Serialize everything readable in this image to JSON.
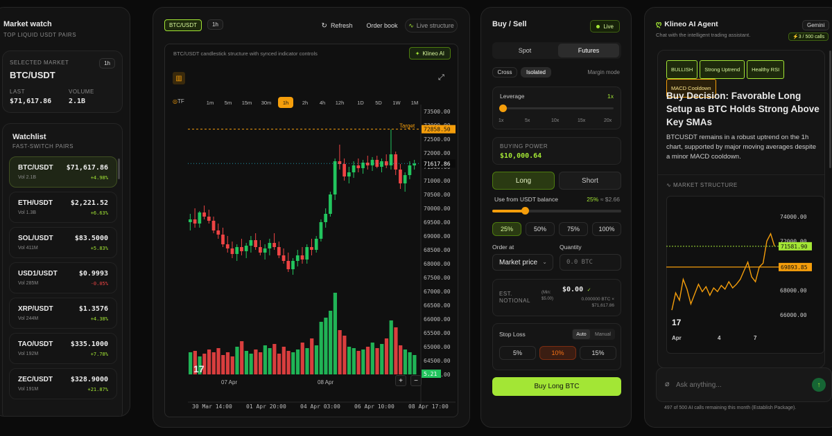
{
  "colors": {
    "accent": "#a3e635",
    "up": "#22c55e",
    "down": "#ef4444",
    "target": "#f59e0b"
  },
  "market_watch": {
    "title": "Market watch",
    "subtitle": "TOP LIQUID USDT PAIRS",
    "selected": {
      "label": "SELECTED MARKET",
      "pair": "BTC/USDT",
      "timeframe": "1h",
      "last_label": "LAST",
      "last": "$71,617.86",
      "volume_label": "VOLUME",
      "volume": "2.1B"
    },
    "watchlist_title": "Watchlist",
    "watchlist_subtitle": "FAST-SWITCH PAIRS",
    "items": [
      {
        "symbol": "BTC/USDT",
        "vol": "Vol 2.1B",
        "price": "$71,617.86",
        "change": "+4.98%",
        "dir": "up"
      },
      {
        "symbol": "ETH/USDT",
        "vol": "Vol 1.3B",
        "price": "$2,221.52",
        "change": "+6.63%",
        "dir": "up"
      },
      {
        "symbol": "SOL/USDT",
        "vol": "Vol 411M",
        "price": "$83.5000",
        "change": "+5.83%",
        "dir": "up"
      },
      {
        "symbol": "USD1/USDT",
        "vol": "Vol 285M",
        "price": "$0.9993",
        "change": "-0.05%",
        "dir": "down"
      },
      {
        "symbol": "XRP/USDT",
        "vol": "Vol 244M",
        "price": "$1.3576",
        "change": "+4.38%",
        "dir": "up"
      },
      {
        "symbol": "TAO/USDT",
        "vol": "Vol 192M",
        "price": "$335.1000",
        "change": "+7.78%",
        "dir": "up"
      },
      {
        "symbol": "ZEC/USDT",
        "vol": "Vol 191M",
        "price": "$328.9000",
        "change": "+21.87%",
        "dir": "up"
      }
    ]
  },
  "chart_panel": {
    "pair_chip": "BTC/USDT",
    "tf_chip": "1h",
    "refresh": "Refresh",
    "order_book": "Order book",
    "live_structure": "Live structure",
    "description": "BTC/USDT candlestick structure with synced indicator controls",
    "klineo_ai": "Klineo AI",
    "tf_label": "TF",
    "timeframes": [
      "1m",
      "5m",
      "15m",
      "30m",
      "1h",
      "2h",
      "4h",
      "12h",
      "1D",
      "5D",
      "1W",
      "1M"
    ],
    "active_tf": "1h",
    "target_label": "Target",
    "target_price": "72858.50",
    "last_price": "71617.86",
    "volume_badge": "5.21",
    "y_ticks": [
      "73500.00",
      "73000.00",
      "72500.00",
      "72000.00",
      "71500.00",
      "71000.00",
      "70500.00",
      "70000.00",
      "69500.00",
      "69000.00",
      "68500.00",
      "68000.00",
      "67500.00",
      "67000.00",
      "66500.00",
      "66000.00",
      "65500.00",
      "65000.00",
      "64500.00",
      "64000.00"
    ],
    "date_marks": [
      "07 Apr",
      "08 Apr"
    ],
    "x_ticks": [
      "30 Mar 14:00",
      "01 Apr 20:00",
      "04 Apr 03:00",
      "06 Apr 10:00",
      "08 Apr 17:00"
    ],
    "zoom_in": "+",
    "zoom_out": "−"
  },
  "chart_data": {
    "type": "candlestick",
    "ylim": [
      64000,
      73500
    ],
    "target": 72858.5,
    "last": 71617.86,
    "candles": [
      [
        69500,
        69800,
        69200,
        69600
      ],
      [
        69600,
        70000,
        69300,
        69450
      ],
      [
        69450,
        69900,
        69300,
        69850
      ],
      [
        69850,
        70100,
        69600,
        69700
      ],
      [
        69700,
        69950,
        69450,
        69550
      ],
      [
        69550,
        69700,
        69100,
        69200
      ],
      [
        69200,
        69450,
        68900,
        69050
      ],
      [
        69050,
        69300,
        68600,
        68700
      ],
      [
        68700,
        69000,
        68400,
        68550
      ],
      [
        68550,
        68800,
        68200,
        68350
      ],
      [
        68350,
        68700,
        68100,
        68600
      ],
      [
        68600,
        68900,
        68300,
        68450
      ],
      [
        68450,
        68750,
        68200,
        68650
      ],
      [
        68650,
        69000,
        68400,
        68850
      ],
      [
        68850,
        69100,
        68500,
        68600
      ],
      [
        68600,
        68850,
        68300,
        68400
      ],
      [
        68400,
        68700,
        68150,
        68550
      ],
      [
        68550,
        68900,
        68300,
        68750
      ],
      [
        68750,
        69100,
        68500,
        68600
      ],
      [
        68600,
        68800,
        68200,
        68300
      ],
      [
        68300,
        68550,
        68000,
        68100
      ],
      [
        68100,
        68400,
        67700,
        67800
      ],
      [
        67800,
        68200,
        67600,
        68100
      ],
      [
        68100,
        68500,
        67900,
        68300
      ],
      [
        68300,
        68600,
        68000,
        68150
      ],
      [
        68150,
        68700,
        68000,
        68600
      ],
      [
        68600,
        68900,
        68300,
        68500
      ],
      [
        68500,
        69000,
        68400,
        68900
      ],
      [
        68900,
        69600,
        68800,
        69500
      ],
      [
        69500,
        70000,
        69300,
        69800
      ],
      [
        69800,
        70600,
        69700,
        70500
      ],
      [
        70500,
        71800,
        70300,
        71700
      ],
      [
        71700,
        72300,
        71400,
        71600
      ],
      [
        71600,
        71800,
        71000,
        71150
      ],
      [
        71150,
        71500,
        70900,
        71300
      ],
      [
        71300,
        71700,
        71100,
        71550
      ],
      [
        71550,
        71800,
        71300,
        71450
      ],
      [
        71450,
        71750,
        71250,
        71650
      ],
      [
        71650,
        71900,
        71400,
        71550
      ],
      [
        71550,
        71850,
        71350,
        71750
      ],
      [
        71750,
        71900,
        71450,
        71500
      ],
      [
        71500,
        71800,
        71300,
        71700
      ],
      [
        71700,
        71950,
        71450,
        71550
      ],
      [
        71550,
        72850,
        71400,
        71950
      ],
      [
        71950,
        72050,
        71200,
        71400
      ],
      [
        71400,
        71600,
        70700,
        70900
      ],
      [
        70900,
        71300,
        70600,
        71200
      ],
      [
        71200,
        71700,
        71050,
        71550
      ],
      [
        71550,
        71750,
        71400,
        71618
      ]
    ],
    "volumes": [
      1.6,
      1.7,
      1.3,
      1.5,
      1.8,
      1.6,
      1.9,
      1.4,
      1.6,
      1.3,
      2.0,
      2.4,
      1.7,
      1.5,
      1.8,
      1.6,
      2.1,
      1.9,
      2.2,
      1.5,
      2.0,
      1.7,
      1.6,
      1.8,
      2.3,
      1.9,
      2.6,
      2.1,
      3.8,
      4.1,
      4.6,
      5.9,
      3.2,
      2.8,
      2.0,
      1.9,
      1.7,
      1.8,
      2.0,
      2.3,
      1.9,
      2.2,
      2.6,
      3.9,
      3.4,
      2.1,
      1.8,
      1.6,
      1.4
    ]
  },
  "order_panel": {
    "title": "Buy / Sell",
    "live": "Live",
    "tabs": [
      "Spot",
      "Futures"
    ],
    "active_tab": "Futures",
    "margin_modes": [
      "Cross",
      "Isolated"
    ],
    "active_margin": "Isolated",
    "margin_label": "Margin mode",
    "leverage_label": "Leverage",
    "leverage_value": "1x",
    "leverage_ticks": [
      "1x",
      "5x",
      "10x",
      "15x",
      "20x"
    ],
    "leverage_level": 0,
    "buying_power_label": "BUYING POWER",
    "buying_power": "$10,000.64",
    "long": "Long",
    "short": "Short",
    "use_label": "Use from USDT balance",
    "use_value": "25%",
    "use_approx": "≈ $2.66",
    "use_level": 0.25,
    "pcts": [
      "25%",
      "50%",
      "75%",
      "100%"
    ],
    "active_pct": "25%",
    "order_at_label": "Order at",
    "order_at_value": "Market price",
    "quantity_label": "Quantity",
    "quantity_placeholder": "0.0 BTC",
    "est_label_1": "EST.",
    "est_label_2": "NOTIONAL",
    "min_1": "(Min:",
    "min_2": "$5.00)",
    "est_value": "$0.00",
    "est_btc": "0.000000 BTC ×",
    "est_price": "$71,617.86",
    "stop_loss_label": "Stop Loss",
    "sl_modes": [
      "Auto",
      "Manual"
    ],
    "active_sl_mode": "Auto",
    "sl_options": [
      "5%",
      "10%",
      "15%"
    ],
    "active_sl": "10%",
    "submit": "Buy Long BTC"
  },
  "ai_panel": {
    "title": "Klineo AI Agent",
    "subtitle": "Chat with the intelligent trading assistant.",
    "model": "Gemini",
    "calls": "3 / 500 calls",
    "tags": [
      "BULLISH",
      "Strong Uptrend",
      "Healthy RSI",
      "MACD Cooldown"
    ],
    "headline": "Buy Decision: Favorable Long Setup as BTC Holds Strong Above Key SMAs",
    "body": "BTCUSDT remains in a robust uptrend on the 1h chart, supported by major moving averages despite a minor MACD cooldown.",
    "structure_label": "MARKET STRUCTURE",
    "mini_ticks": [
      "74000.00",
      "72000.00",
      "70000.00",
      "68000.00",
      "66000.00"
    ],
    "mini_price": "71581.90",
    "mini_level": "69893.85",
    "mini_x": [
      "Apr",
      "4",
      "7"
    ],
    "input_placeholder": "Ask anything...",
    "footer": "497 of 500 AI calls remaining this month (Establish Package)."
  },
  "mini_chart_data": {
    "type": "line",
    "ylim": [
      65000,
      75000
    ],
    "values": [
      66400,
      67800,
      67200,
      68900,
      68100,
      66900,
      67700,
      68500,
      67900,
      68300,
      67600,
      68200,
      67900,
      68400,
      68100,
      68700,
      68200,
      68500,
      68900,
      69600,
      70300,
      69100,
      68700,
      69900,
      70200,
      72000,
      72600,
      71600
    ]
  }
}
